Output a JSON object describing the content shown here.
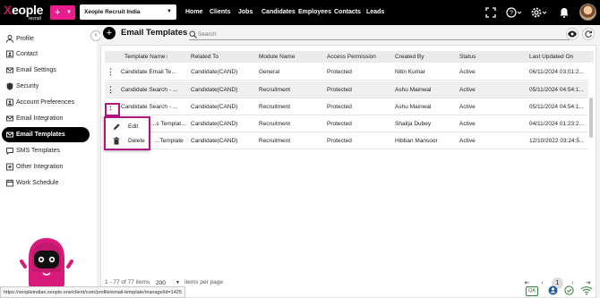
{
  "app": {
    "logo_text": "eople",
    "logo_x": "X",
    "logo_sub": "recruit",
    "org": "Xeople Recruit India"
  },
  "nav": [
    "Home",
    "Clients",
    "Jobs",
    "Candidates",
    "Employees",
    "Contacts",
    "Leads"
  ],
  "header_icons": [
    "fullscreen-icon",
    "help-icon",
    "settings-icon",
    "bell-icon"
  ],
  "sidebar": {
    "items": [
      {
        "label": "Profile",
        "icon": "user-icon"
      },
      {
        "label": "Contact",
        "icon": "contact-card-icon"
      },
      {
        "label": "Email Settings",
        "icon": "mail-icon"
      },
      {
        "label": "Security",
        "icon": "shield-icon"
      },
      {
        "label": "Account Preferences",
        "icon": "preferences-icon"
      },
      {
        "label": "Email Integration",
        "icon": "integration-mail-icon"
      },
      {
        "label": "Email Templates",
        "icon": "template-icon",
        "active": true
      },
      {
        "label": "SMS Templates",
        "icon": "sms-icon"
      },
      {
        "label": "Other Integration",
        "icon": "other-integration-icon"
      },
      {
        "label": "Work Schedule",
        "icon": "calendar-icon"
      }
    ]
  },
  "page": {
    "title": "Email Templates",
    "search_placeholder": "Search"
  },
  "table": {
    "columns": [
      "Template Name",
      "Related To",
      "Module Name",
      "Access Permission",
      "Created By",
      "Status",
      "Last Updated On"
    ],
    "sort_column": "Template Name",
    "sort_icon": "↑",
    "rows": [
      [
        "Candidate Email Te...",
        "Candidate(CAND)",
        "General",
        "Protected",
        "Nitin Kumar",
        "Active",
        "06/11/2024 03:01:2..."
      ],
      [
        "Candidate Search - ...",
        "Candidate(CAND)",
        "Recruitment",
        "Protected",
        "Ashu Mainwal",
        "Active",
        "05/11/2024 04:54:1..."
      ],
      [
        "Candidate Search - ...",
        "Candidate(CAND)",
        "Recruitment",
        "Protected",
        "Ashu Mainwal",
        "Active",
        "05/11/2024 04:54:1..."
      ],
      [
        "...s Templat...",
        "Candidate(CAND)",
        "Recruitment",
        "Protected",
        "Shailja Dubey",
        "Active",
        "04/11/2024 01:23:2..."
      ],
      [
        "...Template",
        "Candidate(CAND)",
        "Recruitment",
        "Protected",
        "Hibban Mansoor",
        "Active",
        "12/10/2022 03:24:5..."
      ]
    ]
  },
  "context_menu": {
    "items": [
      {
        "label": "Edit",
        "icon": "pencil-icon"
      },
      {
        "label": "Delete",
        "icon": "trash-icon"
      }
    ]
  },
  "pagination": {
    "range_text": "1 - 77 of 77 items",
    "per_page": "200",
    "per_page_label": "items per page",
    "current_page": "1"
  },
  "status_bar": {
    "url": "https://xeopleindian.xeople.one/client/com/profile/email-template/manage/id=1425",
    "qa": "QA"
  },
  "colors": {
    "accent": "#e91e8c",
    "highlight": "#b0167f",
    "topbar": "#000000"
  }
}
